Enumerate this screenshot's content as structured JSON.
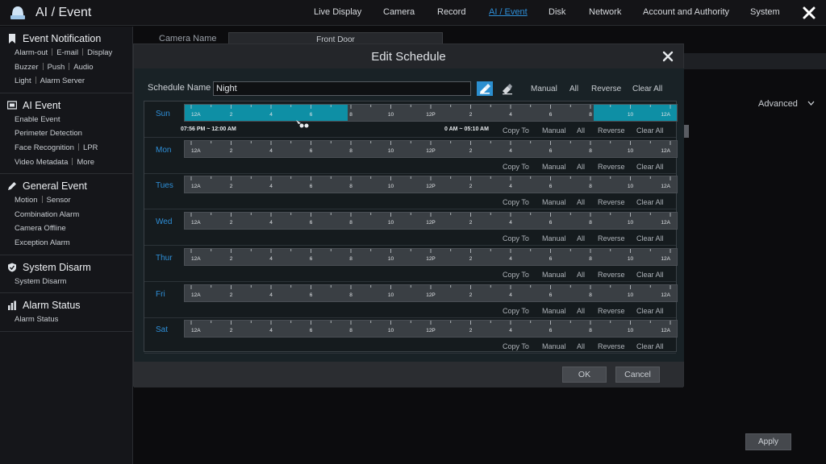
{
  "app": {
    "title": "AI / Event",
    "nav": [
      {
        "label": "Live Display",
        "active": false
      },
      {
        "label": "Camera",
        "active": false
      },
      {
        "label": "Record",
        "active": false
      },
      {
        "label": "AI / Event",
        "active": true
      },
      {
        "label": "Disk",
        "active": false
      },
      {
        "label": "Network",
        "active": false
      },
      {
        "label": "Account and Authority",
        "active": false
      },
      {
        "label": "System",
        "active": false
      }
    ],
    "accent_color": "#2e8fd8"
  },
  "sidebar": {
    "groups": [
      {
        "title": "Event Notification",
        "icon": "bookmark-icon",
        "lines": [
          [
            "Alarm-out",
            "E-mail",
            "Display"
          ],
          [
            "Buzzer",
            "Push",
            "Audio"
          ],
          [
            "Light",
            "Alarm Server"
          ]
        ]
      },
      {
        "title": "AI Event",
        "icon": "ai-icon",
        "lines": [
          [
            "Enable Event"
          ],
          [
            "Perimeter Detection"
          ],
          [
            "Face Recognition",
            "LPR"
          ],
          [
            "Video Metadata",
            "More"
          ]
        ]
      },
      {
        "title": "General Event",
        "icon": "pencil-icon",
        "lines": [
          [
            "Motion",
            "Sensor"
          ],
          [
            "Combination Alarm"
          ],
          [
            "Camera Offline"
          ],
          [
            "Exception Alarm"
          ]
        ]
      },
      {
        "title": "System Disarm",
        "icon": "shield-icon",
        "lines": [
          [
            "System Disarm"
          ]
        ]
      },
      {
        "title": "Alarm Status",
        "icon": "chart-icon",
        "lines": [
          [
            "Alarm Status"
          ]
        ]
      }
    ]
  },
  "background": {
    "camera_name_label": "Camera Name",
    "camera_name_value": "Front Door",
    "advanced_label": "Advanced",
    "apply_label": "Apply"
  },
  "modal": {
    "title": "Edit Schedule",
    "schedule_name_label": "Schedule Name",
    "schedule_name_value": "Night",
    "header_buttons": [
      "Manual",
      "All",
      "Reverse",
      "Clear All"
    ],
    "row_buttons": [
      "Copy To",
      "Manual",
      "All",
      "Reverse",
      "Clear All"
    ],
    "hour_ticks": [
      "12A",
      "2",
      "4",
      "6",
      "8",
      "10",
      "12P",
      "2",
      "4",
      "6",
      "8",
      "10",
      "12A"
    ],
    "segment_color": "#0e8fa5",
    "days": [
      {
        "name": "Sun",
        "segments": [
          [
            0,
            7.93
          ],
          [
            19.93,
            24
          ]
        ],
        "range_left": "07:56 PM ~ 12:00 AM",
        "range_right": "0 AM ~ 05:10 AM"
      },
      {
        "name": "Mon",
        "segments": []
      },
      {
        "name": "Tues",
        "segments": []
      },
      {
        "name": "Wed",
        "segments": []
      },
      {
        "name": "Thur",
        "segments": []
      },
      {
        "name": "Fri",
        "segments": []
      },
      {
        "name": "Sat",
        "segments": []
      }
    ],
    "ok_label": "OK",
    "cancel_label": "Cancel"
  }
}
